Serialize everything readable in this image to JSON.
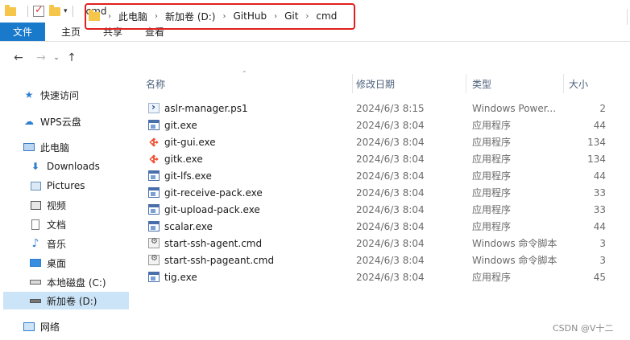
{
  "window": {
    "title": "cmd"
  },
  "ribbon": {
    "file": "文件",
    "home": "主页",
    "share": "共享",
    "view": "查看"
  },
  "address": {
    "crumbs": [
      "此电脑",
      "新加卷 (D:)",
      "GitHub",
      "Git",
      "cmd"
    ]
  },
  "sidebar": {
    "quick_access": "快速访问",
    "wps_cloud": "WPS云盘",
    "this_pc": "此电脑",
    "downloads": "Downloads",
    "pictures": "Pictures",
    "videos": "视频",
    "documents": "文档",
    "music": "音乐",
    "desktop": "桌面",
    "local_disk": "本地磁盘 (C:)",
    "new_volume": "新加卷 (D:)",
    "network": "网络"
  },
  "columns": {
    "name": "名称",
    "date": "修改日期",
    "type": "类型",
    "size": "大小"
  },
  "files": [
    {
      "name": "aslr-manager.ps1",
      "date": "2024/6/3 8:15",
      "type": "Windows Power...",
      "size": "2",
      "icon": "ps1"
    },
    {
      "name": "git.exe",
      "date": "2024/6/3 8:04",
      "type": "应用程序",
      "size": "44",
      "icon": "exe"
    },
    {
      "name": "git-gui.exe",
      "date": "2024/6/3 8:04",
      "type": "应用程序",
      "size": "134",
      "icon": "git"
    },
    {
      "name": "gitk.exe",
      "date": "2024/6/3 8:04",
      "type": "应用程序",
      "size": "134",
      "icon": "git"
    },
    {
      "name": "git-lfs.exe",
      "date": "2024/6/3 8:04",
      "type": "应用程序",
      "size": "44",
      "icon": "exe"
    },
    {
      "name": "git-receive-pack.exe",
      "date": "2024/6/3 8:04",
      "type": "应用程序",
      "size": "33",
      "icon": "exe"
    },
    {
      "name": "git-upload-pack.exe",
      "date": "2024/6/3 8:04",
      "type": "应用程序",
      "size": "33",
      "icon": "exe"
    },
    {
      "name": "scalar.exe",
      "date": "2024/6/3 8:04",
      "type": "应用程序",
      "size": "44",
      "icon": "exe"
    },
    {
      "name": "start-ssh-agent.cmd",
      "date": "2024/6/3 8:04",
      "type": "Windows 命令脚本",
      "size": "3",
      "icon": "cmd"
    },
    {
      "name": "start-ssh-pageant.cmd",
      "date": "2024/6/3 8:04",
      "type": "Windows 命令脚本",
      "size": "3",
      "icon": "cmd"
    },
    {
      "name": "tig.exe",
      "date": "2024/6/3 8:04",
      "type": "应用程序",
      "size": "45",
      "icon": "exe"
    }
  ],
  "watermark": "CSDN @V十二",
  "colors": {
    "accent": "#1979ca",
    "highlight_border": "#e0201e",
    "selected": "#cce4f7",
    "folder": "#f6c64a"
  }
}
